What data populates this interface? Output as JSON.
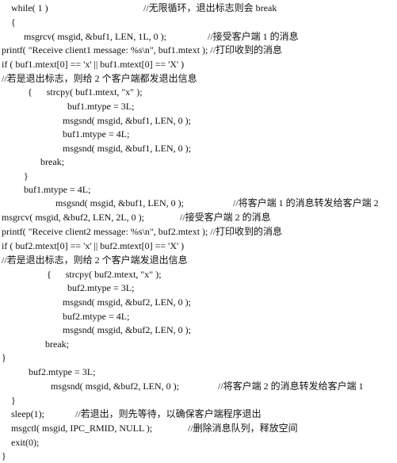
{
  "lines": [
    {
      "code": "while( 1 )",
      "comment": "//无限循环，退出标志则会 break"
    },
    {
      "code": "{",
      "comment": ""
    },
    {
      "code": "msgrcv( msgid, &buf1, LEN, 1L, 0 );",
      "comment": "//接受客户端 1 的消息"
    },
    {
      "code": "printf( \"Receive client1 message: %s\\n\", buf1.mtext ); //打印收到的消息",
      "comment": ""
    },
    {
      "code": "if ( buf1.mtext[0] == 'x' || buf1.mtext[0] == 'X' )",
      "comment": ""
    },
    {
      "code": "//若是退出标志，则给 2 个客户端都发退出信息",
      "comment": ""
    },
    {
      "code": "{      strcpy( buf1.mtext, \"x\" );",
      "comment": ""
    },
    {
      "code": "buf1.mtype = 3L;",
      "comment": ""
    },
    {
      "code": "msgsnd( msgid, &buf1, LEN, 0 );",
      "comment": ""
    },
    {
      "code": "buf1.mtype = 4L;",
      "comment": ""
    },
    {
      "code": "msgsnd( msgid, &buf1, LEN, 0 );",
      "comment": ""
    },
    {
      "code": "break;",
      "comment": ""
    },
    {
      "code": "}",
      "comment": ""
    },
    {
      "code": "buf1.mtype = 4L;",
      "comment": ""
    },
    {
      "code": "msgsnd( msgid, &buf1, LEN, 0 );",
      "comment": "//将客户端 1 的消息转发给客户端 2"
    },
    {
      "code": "msgrcv( msgid, &buf2, LEN, 2L, 0 );",
      "comment": "//接受客户端 2 的消息"
    },
    {
      "code": "printf( \"Receive client2 message: %s\\n\", buf2.mtext ); //打印收到的消息",
      "comment": ""
    },
    {
      "code": "if ( buf2.mtext[0] == 'x' || buf2.mtext[0] == 'X' )",
      "comment": ""
    },
    {
      "code": "//若是退出标志，则给 2 个客户端发退出信息",
      "comment": ""
    },
    {
      "code": "{      strcpy( buf2.mtext, \"x\" );",
      "comment": ""
    },
    {
      "code": "buf2.mtype = 3L;",
      "comment": ""
    },
    {
      "code": "msgsnd( msgid, &buf2, LEN, 0 );",
      "comment": ""
    },
    {
      "code": "buf2.mtype = 4L;",
      "comment": ""
    },
    {
      "code": "msgsnd( msgid, &buf2, LEN, 0 );",
      "comment": ""
    },
    {
      "code": "break;",
      "comment": ""
    },
    {
      "code": "}",
      "comment": ""
    },
    {
      "code": "buf2.mtype = 3L;",
      "comment": ""
    },
    {
      "code": "msgsnd( msgid, &buf2, LEN, 0 );",
      "comment": "//将客户端 2 的消息转发给客户端 1"
    },
    {
      "code": "}",
      "comment": ""
    },
    {
      "code": "sleep(1);",
      "comment": "//若退出，则先等待，以确保客户端程序退出"
    },
    {
      "code": "msgctl( msgid, IPC_RMID, NULL );",
      "comment": "//删除消息队列，释放空间"
    },
    {
      "code": "exit(0);",
      "comment": ""
    },
    {
      "code": "}",
      "comment": ""
    }
  ]
}
